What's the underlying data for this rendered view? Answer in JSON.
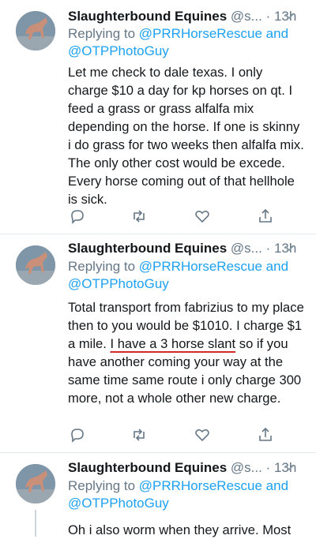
{
  "tweets": [
    {
      "name": "Slaughterbound Equines",
      "handle": "@s...",
      "time": "· 13h",
      "replying_prefix": "Replying to",
      "mention1": "@PRRHorseRescue",
      "and": " and",
      "mention2": "@OTPPhotoGuy",
      "text": "Let me check to dale texas. I only charge $10 a day for kp horses on qt. I feed a grass or grass alfalfa mix depending on the horse. If one is skinny i do grass for two weeks then alfalfa mix. The only other cost would be excede. Every horse coming out of that hellhole is sick."
    },
    {
      "name": "Slaughterbound Equines",
      "handle": "@s...",
      "time": "· 13h",
      "replying_prefix": "Replying to",
      "mention1": "@PRRHorseRescue",
      "and": " and",
      "mention2": "@OTPPhotoGuy",
      "text_before": "Total transport from fabrizius to my place then to you would be $1010. I charge $1 a mile. ",
      "text_underlined": "I have a 3 horse slant",
      "text_after": " so if you have another coming your way at the same time same route i only charge 300 more, not a whole other new charge."
    },
    {
      "name": "Slaughterbound Equines",
      "handle": "@s...",
      "time": "· 13h",
      "replying_prefix": "Replying to",
      "mention1": "@PRRHorseRescue",
      "and": " and",
      "mention2": "@OTPPhotoGuy",
      "text": "Oh i also worm when they arrive. Most"
    }
  ],
  "icons": [
    "reply-icon",
    "retweet-icon",
    "like-icon",
    "share-icon",
    "chevron-down-icon"
  ],
  "colors": {
    "accent": "#1da1f2",
    "muted": "#657786",
    "underline": "#d22a2a"
  }
}
